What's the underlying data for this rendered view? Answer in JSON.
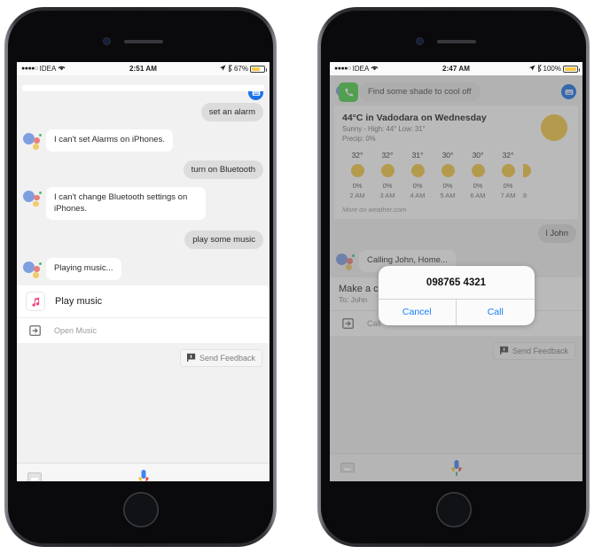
{
  "phones": [
    {
      "id": "left",
      "status": {
        "carrier": "IDEA",
        "time": "2:51 AM",
        "battery": "67%",
        "battery_pct": 67
      },
      "messages": [
        {
          "type": "user",
          "text": "set an alarm",
          "avatar": "keyboard-avatar-icon"
        },
        {
          "type": "assistant",
          "text": "I can't set Alarms on iPhones."
        },
        {
          "type": "user",
          "text": "turn on Bluetooth"
        },
        {
          "type": "assistant",
          "text": "I can't change Bluetooth settings on iPhones."
        },
        {
          "type": "user",
          "text": "play some music"
        },
        {
          "type": "assistant",
          "text": "Playing music..."
        }
      ],
      "card": {
        "icon": "apple-music-icon",
        "title": "Play music",
        "subtitle": "",
        "action": "Open Music"
      },
      "feedback": "Send Feedback",
      "bottom": {
        "keyboard": "keyboard-icon",
        "mic": "mic-icon"
      }
    },
    {
      "id": "right",
      "status": {
        "carrier": "IDEA",
        "time": "2:47 AM",
        "battery": "100%",
        "battery_pct": 100
      },
      "suggestion": "Find some shade to cool off",
      "weather": {
        "title": "44°C in Vadodara on Wednesday",
        "conditions": "Sunny - High: 44° Low: 31°",
        "precip": "Precip: 0%",
        "more": "More on weather.com",
        "hours": [
          {
            "time": "2 AM",
            "temp": "32°",
            "precip": "0%"
          },
          {
            "time": "3 AM",
            "temp": "32°",
            "precip": "0%"
          },
          {
            "time": "4 AM",
            "temp": "31°",
            "precip": "0%"
          },
          {
            "time": "5 AM",
            "temp": "30°",
            "precip": "0%"
          },
          {
            "time": "6 AM",
            "temp": "30°",
            "precip": "0%"
          },
          {
            "time": "7 AM",
            "temp": "32°",
            "precip": "0%"
          },
          {
            "time": "8",
            "temp": "",
            "precip": ""
          }
        ]
      },
      "hidden_user_bubble": "l John",
      "assistant_reply": "Calling John, Home...",
      "card": {
        "icon": "green-phone-icon",
        "title": "Make a call",
        "subtitle": "To: John",
        "action": "Call"
      },
      "feedback": "Send Feedback",
      "dialog": {
        "number": "098765 4321",
        "cancel": "Cancel",
        "confirm": "Call"
      },
      "bottom": {
        "keyboard": "keyboard-icon",
        "mic": "mic-icon"
      }
    }
  ],
  "colors": {
    "accent_blue": "#1a73e8",
    "ios_blue": "#157efb",
    "sun_yellow": "#f5c842",
    "phone_green": "#4cd04c"
  }
}
